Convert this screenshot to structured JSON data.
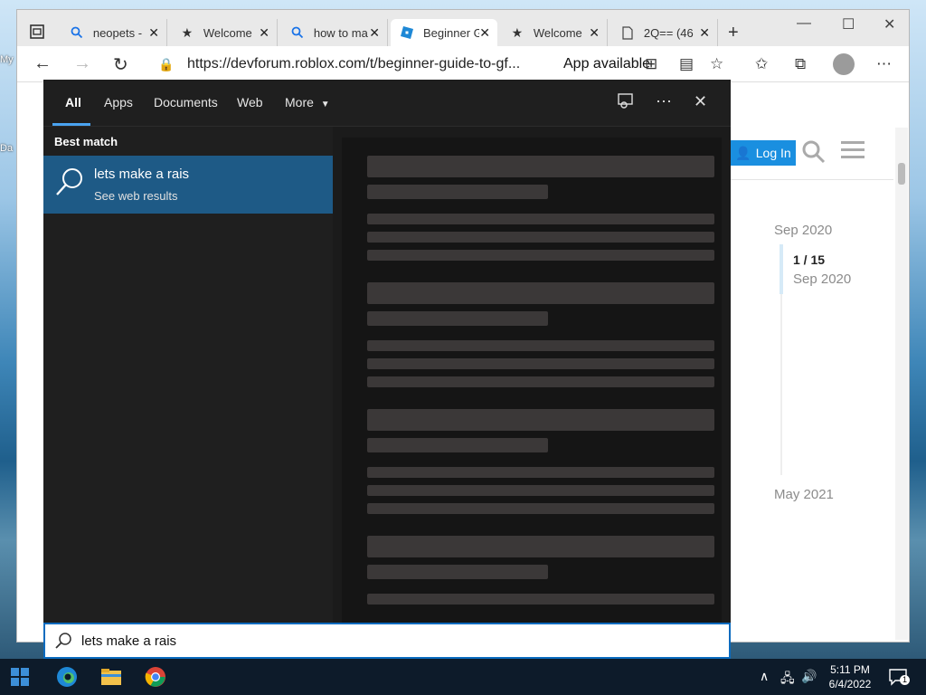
{
  "desktop": {
    "labels": [
      "My",
      "Da"
    ]
  },
  "browser": {
    "tabs": [
      {
        "title": "neopets -",
        "icon": "search-icon",
        "active": false
      },
      {
        "title": "Welcome",
        "icon": "star-icon",
        "active": false
      },
      {
        "title": "how to ma",
        "icon": "search-icon",
        "active": false
      },
      {
        "title": "Beginner G",
        "icon": "roblox-icon",
        "active": true
      },
      {
        "title": "Welcome",
        "icon": "star-icon",
        "active": false
      },
      {
        "title": "2Q== (46",
        "icon": "page-icon",
        "active": false
      }
    ],
    "url": "https://devforum.roblox.com/t/beginner-guide-to-gf...",
    "app_available": "App available"
  },
  "page": {
    "login_label": "Log In",
    "date_top": "Sep 2020",
    "counter": "1 / 15",
    "date_counter": "Sep 2020",
    "date_bottom": "May 2021"
  },
  "search_panel": {
    "tabs": [
      "All",
      "Apps",
      "Documents",
      "Web",
      "More"
    ],
    "best_match_label": "Best match",
    "best_title": "lets make a rais",
    "best_sub": "See web results",
    "query": "lets make a rais"
  },
  "taskbar": {
    "time": "5:11 PM",
    "date": "6/4/2022",
    "notification_count": "1"
  },
  "colors": {
    "accent": "#1e5a86",
    "search_border": "#0b6bbf",
    "login_button": "#1a8fe0"
  }
}
